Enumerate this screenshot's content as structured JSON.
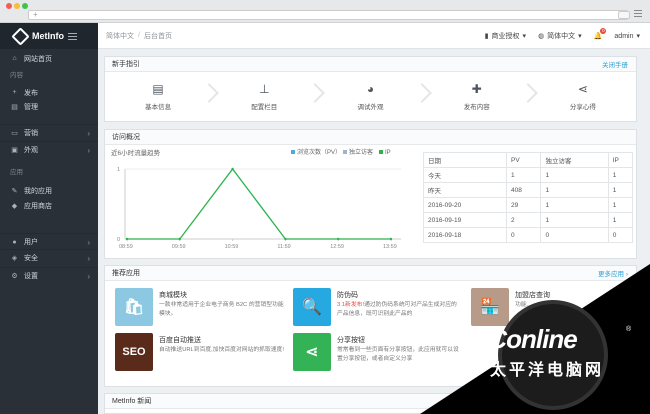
{
  "browser": {
    "tab_plus": "+"
  },
  "sidebar": {
    "brand": "MetInfo",
    "items": [
      {
        "name": "home",
        "icon": "home-icon",
        "glyph": "⌂",
        "label": "网站首页"
      },
      {
        "name": "section-content",
        "label": "内容"
      },
      {
        "name": "publish",
        "icon": "plus-icon",
        "glyph": "+",
        "label": "发布"
      },
      {
        "name": "manage",
        "icon": "list-icon",
        "glyph": "▤",
        "label": "管理"
      },
      {
        "name": "marketing",
        "icon": "megaphone-icon",
        "glyph": "▭",
        "label": "营销",
        "arrow": "›"
      },
      {
        "name": "appearance",
        "icon": "monitor-icon",
        "glyph": "▣",
        "label": "外观",
        "arrow": "›"
      },
      {
        "name": "section-apps",
        "label": "应用"
      },
      {
        "name": "my-apps",
        "icon": "leaf-icon",
        "glyph": "✎",
        "label": "我的应用"
      },
      {
        "name": "app-store",
        "icon": "cube-icon",
        "glyph": "◆",
        "label": "应用商店"
      },
      {
        "name": "users",
        "icon": "user-icon",
        "glyph": "●",
        "label": "用户",
        "arrow": "›"
      },
      {
        "name": "security",
        "icon": "shield-icon",
        "glyph": "◈",
        "label": "安全",
        "arrow": "›"
      },
      {
        "name": "settings",
        "icon": "gear-icon",
        "glyph": "⚙",
        "label": "设置",
        "arrow": "›"
      }
    ]
  },
  "topbar": {
    "breadcrumb": [
      "简体中文",
      "后台首页"
    ],
    "license": "商业授权",
    "lang": "简体中文",
    "notif_count": "0",
    "user": "admin"
  },
  "guide": {
    "title": "新手指引",
    "link": "关闭手册",
    "steps": [
      {
        "icon": "info-card-icon",
        "glyph": "▤",
        "label": "基本信息"
      },
      {
        "icon": "sitemap-icon",
        "glyph": "⊥",
        "label": "配置栏目"
      },
      {
        "icon": "palette-icon",
        "glyph": "◕",
        "label": "调试外观"
      },
      {
        "icon": "plus-icon",
        "glyph": "✚",
        "label": "发布内容"
      },
      {
        "icon": "share-icon",
        "glyph": "⋖",
        "label": "分享心得"
      }
    ]
  },
  "visits": {
    "title": "访问概况",
    "chart_title": "近6小时流量趋势",
    "legend": [
      {
        "label": "浏览次数（PV）",
        "color": "#4fa9dc"
      },
      {
        "label": "独立访客",
        "color": "#9fb4c8"
      },
      {
        "label": "IP",
        "color": "#2bb24c"
      }
    ],
    "table_headers": [
      "日期",
      "PV",
      "独立访客",
      "IP"
    ],
    "table_rows": [
      [
        "今天",
        "1",
        "1",
        "1"
      ],
      [
        "昨天",
        "408",
        "1",
        "1"
      ],
      [
        "2016-09-20",
        "29",
        "1",
        "1"
      ],
      [
        "2016-09-19",
        "2",
        "1",
        "1"
      ],
      [
        "2016-09-18",
        "0",
        "0",
        "0"
      ]
    ]
  },
  "chart_data": {
    "type": "line",
    "title": "近6小时流量趋势",
    "x": [
      "08:59",
      "09:59",
      "10:59",
      "11:59",
      "12:59",
      "13:59"
    ],
    "ylim": [
      0,
      1
    ],
    "yticks": [
      "1",
      "0"
    ],
    "series": [
      {
        "name": "IP",
        "values": [
          0,
          0,
          1,
          0,
          0,
          0
        ],
        "color": "#2bb24c"
      }
    ],
    "legend": "top-right",
    "grid": true
  },
  "recommend": {
    "title": "推荐应用",
    "link": "更多应用 ›",
    "apps": [
      {
        "name": "mall",
        "title": "商城模块",
        "desc": "一款非常适用于企业电子商务 B2C 的营销型功能模块。",
        "color": "#8dc8e3",
        "glyph": "🛍"
      },
      {
        "name": "anti-fake",
        "title": "防伪码",
        "badge": "3.1新发布!",
        "desc": "通过防伪码系统可对产品生成对应的产品信息，既可识别此产品的",
        "color": "#26a9e0",
        "glyph": "🔍"
      },
      {
        "name": "store",
        "title": "加盟店查询",
        "desc": "功能...",
        "color": "#b79a87",
        "glyph": "🏪"
      },
      {
        "name": "baidu",
        "title": "百度自动推送",
        "desc": "自动推送URL到百度,加快百度对网站的抓取速度!",
        "color": "#5a2a1a",
        "glyph": "SEO"
      },
      {
        "name": "share",
        "title": "分享按钮",
        "desc": "常常看到一些页面有分享按钮，此应用就可以设置分享按钮，或者自定义分享",
        "color": "#34b256",
        "glyph": "⋖"
      }
    ]
  },
  "news": {
    "title": "MetInfo 新闻"
  },
  "watermark": {
    "brand": "PConline",
    "sub": "太平洋电脑网",
    "reg": "®"
  }
}
